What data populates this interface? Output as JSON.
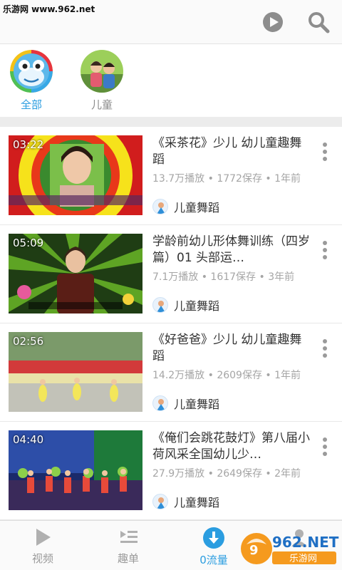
{
  "header": {
    "watermark": "乐游网 www.962.net",
    "icons": [
      "play-circle-icon",
      "search-icon"
    ]
  },
  "categories": [
    {
      "label": "全部",
      "selected": true,
      "icon": "frog-avatar-icon"
    },
    {
      "label": "儿童",
      "selected": false,
      "icon": "kids-photo-avatar"
    }
  ],
  "videos": [
    {
      "duration": "03:22",
      "title": "《采茶花》少儿 幼儿童趣舞蹈",
      "meta": "13.7万播放 • 1772保存 • 1年前",
      "channel": "儿童舞蹈"
    },
    {
      "duration": "05:09",
      "title": "学龄前幼儿形体舞训练（四岁篇）01 头部运…",
      "meta": "7.1万播放 • 1617保存 • 3年前",
      "channel": "儿童舞蹈"
    },
    {
      "duration": "02:56",
      "title": "《好爸爸》少儿 幼儿童趣舞蹈",
      "meta": "14.2万播放 • 2609保存 • 1年前",
      "channel": "儿童舞蹈"
    },
    {
      "duration": "04:40",
      "title": "《俺们会跳花鼓灯》第八届小荷风采全国幼儿少…",
      "meta": "27.9万播放 • 2649保存 • 2年前",
      "channel": "儿童舞蹈"
    }
  ],
  "tabs": [
    {
      "label": "视频",
      "icon": "play-triangle-icon",
      "active": false
    },
    {
      "label": "趣单",
      "icon": "playlist-icon",
      "active": false
    },
    {
      "label": "0流量",
      "icon": "download-icon",
      "active": true
    },
    {
      "label": "",
      "icon": "person-icon",
      "active": false
    }
  ],
  "corner_logo": {
    "text": "962.NET",
    "subtext": "乐游网"
  },
  "colors": {
    "accent": "#2b9de0",
    "muted": "#a5a5a5"
  }
}
